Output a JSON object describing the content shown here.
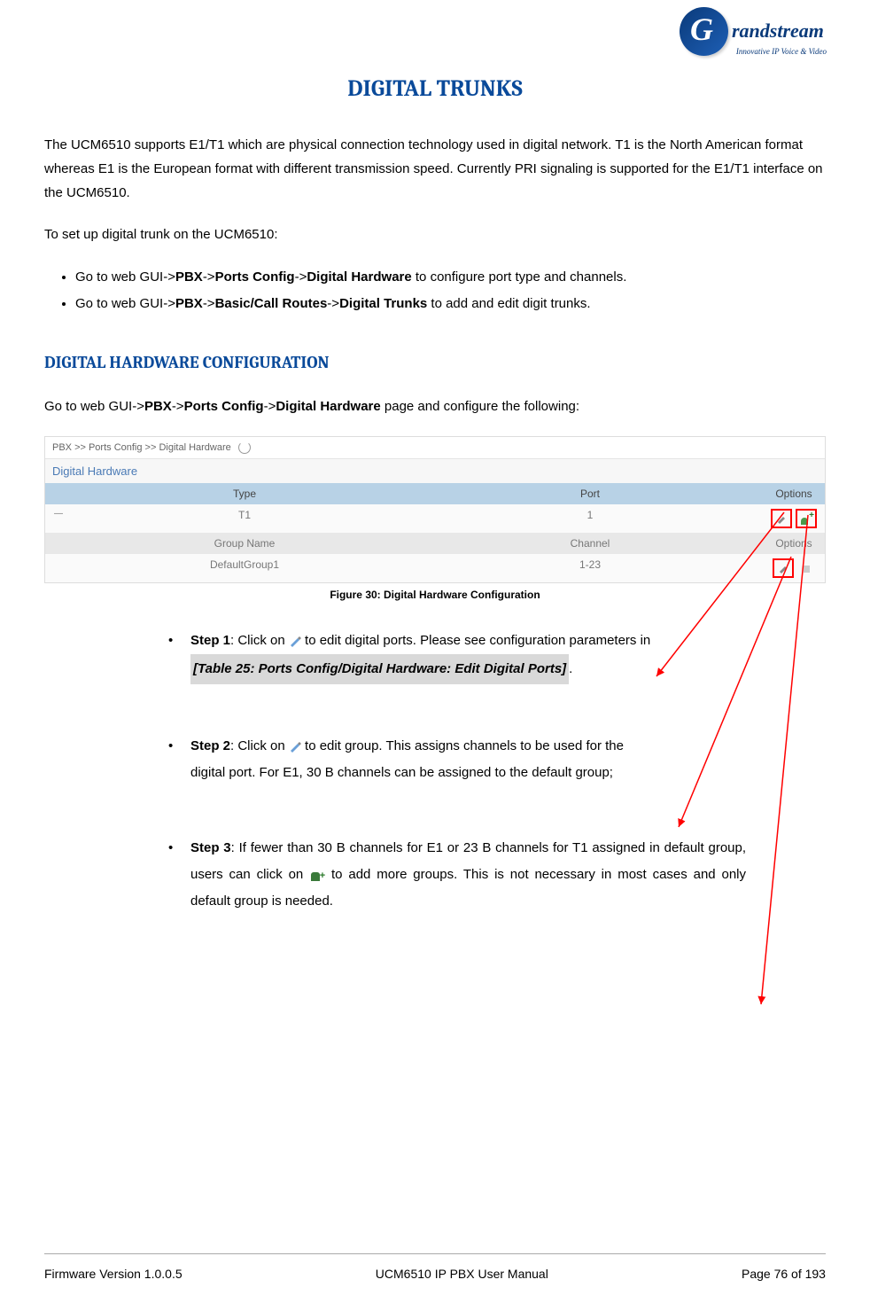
{
  "logo": {
    "brand": "randstream",
    "tagline": "Innovative IP Voice & Video"
  },
  "title": "DIGITAL TRUNKS",
  "intro": "The UCM6510 supports E1/T1 which are physical connection technology used in digital network. T1 is the North American format whereas E1 is the European format with different transmission speed. Currently PRI signaling is supported for the E1/T1 interface on the UCM6510.",
  "setup_lead": "To set up digital trunk on the UCM6510:",
  "bullets": {
    "b1_pre": "Go to web GUI->",
    "b1_bold1": "PBX",
    "b1_mid1": "->",
    "b1_bold2": "Ports Config",
    "b1_mid2": "->",
    "b1_bold3": "Digital Hardware",
    "b1_post": " to configure port type and channels.",
    "b2_pre": "Go to web GUI->",
    "b2_bold1": "PBX",
    "b2_mid1": "->",
    "b2_bold2": "Basic/Call Routes",
    "b2_mid2": "->",
    "b2_bold3": "Digital Trunks",
    "b2_post": " to add and edit digit trunks."
  },
  "section_title": "DIGITAL HARDWARE CONFIGURATION",
  "config_lead_pre": "Go to web GUI->",
  "config_lead_b1": "PBX",
  "config_lead_m1": "->",
  "config_lead_b2": "Ports Config",
  "config_lead_m2": "->",
  "config_lead_b3": "Digital Hardware",
  "config_lead_post": " page and configure the following:",
  "screenshot": {
    "breadcrumb": "PBX >> Ports Config >> Digital Hardware",
    "panel": "Digital Hardware",
    "hdr_type": "Type",
    "hdr_port": "Port",
    "hdr_options": "Options",
    "row_type": "T1",
    "row_port": "1",
    "sub_hdr_name": "Group Name",
    "sub_hdr_channel": "Channel",
    "sub_hdr_options": "Options",
    "sub_row_name": "DefaultGroup1",
    "sub_row_channel": "1-23"
  },
  "caption": "Figure 30: Digital Hardware Configuration",
  "steps": {
    "s1_label": "Step 1",
    "s1_a": ": Click on ",
    "s1_b": " to edit digital ports. Please see configuration parameters in",
    "s1_ref": "[Table 25: Ports Config/Digital Hardware: Edit Digital Ports]",
    "s2_label": "Step 2",
    "s2_a": ": Click on ",
    "s2_b": " to edit group. This assigns channels to be used for the",
    "s2_c": "digital port. For E1, 30 B channels can be assigned to the default group;",
    "s3_label": "Step 3",
    "s3_a": ": If fewer than 30 B channels for E1 or 23 B channels for T1 assigned in default group, users can click on ",
    "s3_b": " to add more groups. This is not necessary in most cases and only default group is needed."
  },
  "footer": {
    "left": "Firmware Version 1.0.0.5",
    "center": "UCM6510 IP PBX User Manual",
    "right": "Page 76 of 193"
  }
}
